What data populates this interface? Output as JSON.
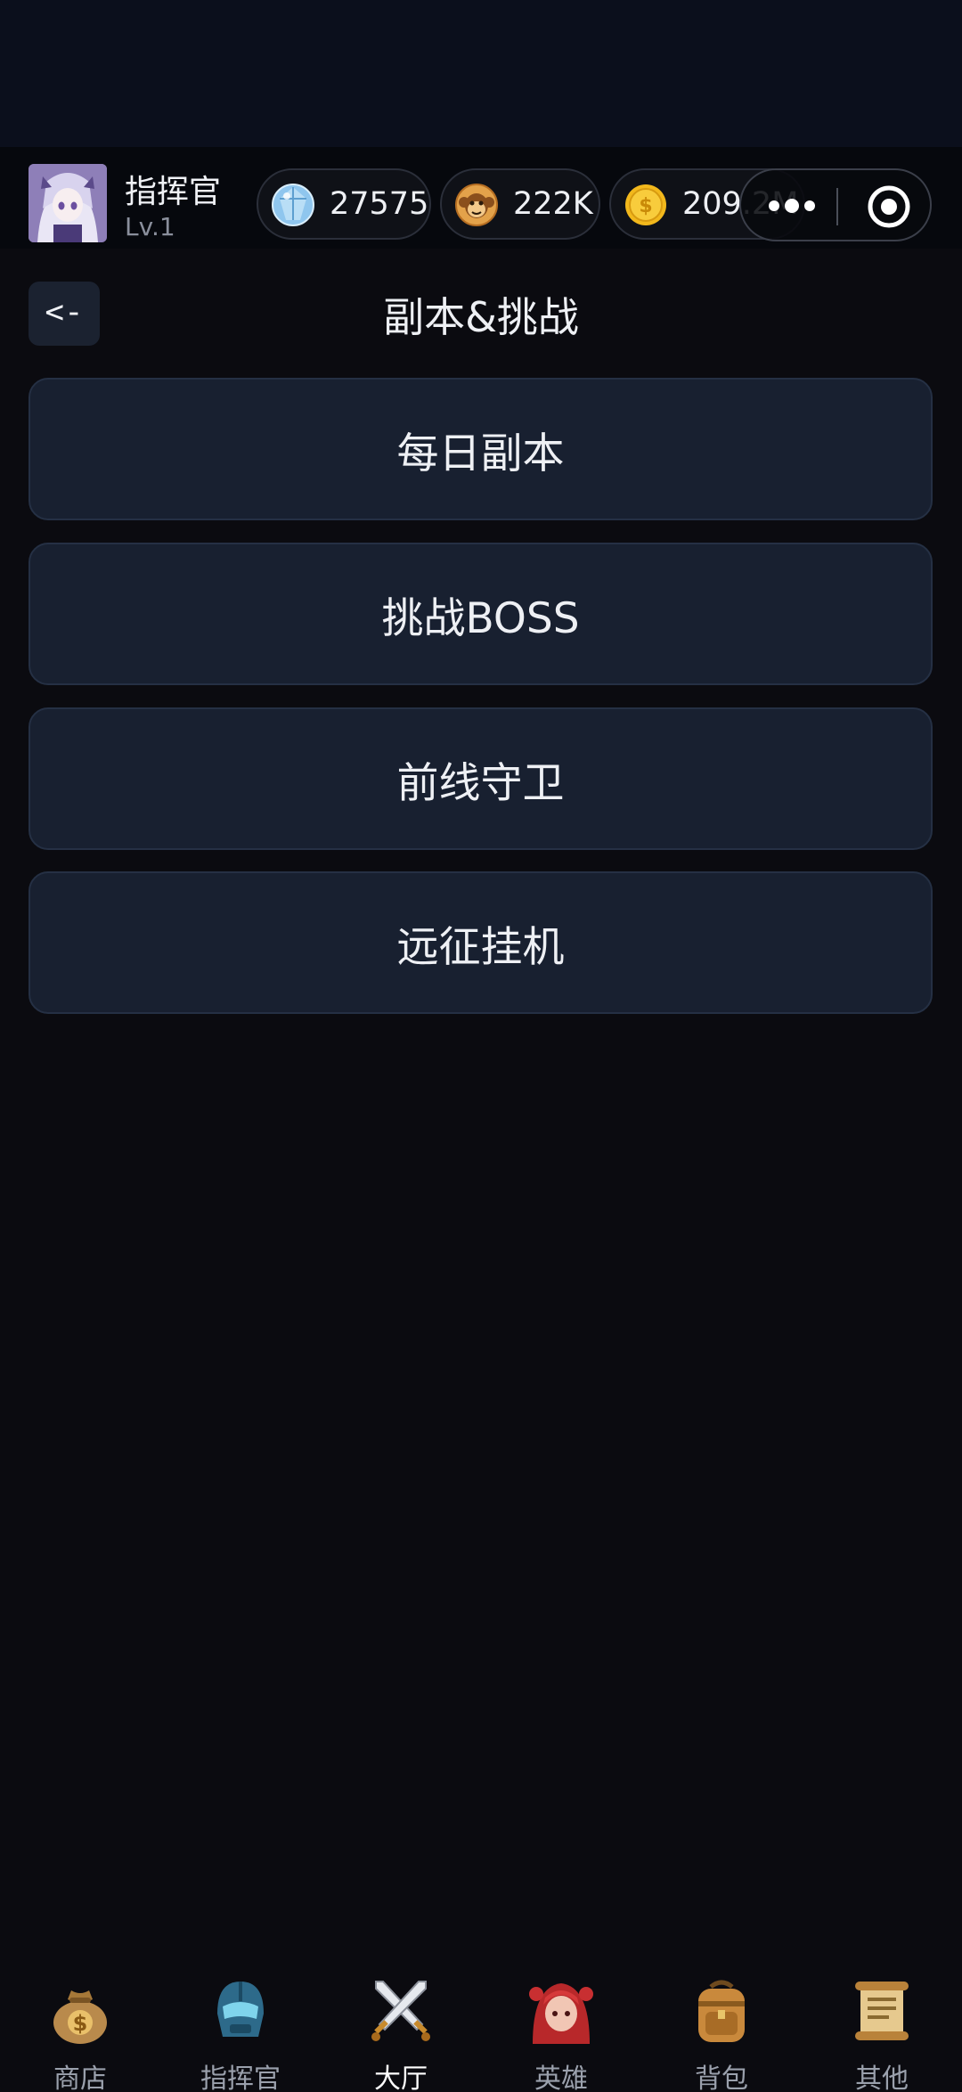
{
  "player": {
    "name": "指挥官",
    "level": "Lv.1"
  },
  "currencies": [
    {
      "icon": "gem-icon",
      "value": "27575"
    },
    {
      "icon": "monkey-coin-icon",
      "value": "222K"
    },
    {
      "icon": "gold-coin-icon",
      "value": "209.2M"
    }
  ],
  "header": {
    "back_label": "<-",
    "title": "副本&挑战"
  },
  "menu": [
    {
      "label": "每日副本"
    },
    {
      "label": "挑战BOSS"
    },
    {
      "label": "前线守卫"
    },
    {
      "label": "远征挂机"
    }
  ],
  "bottom_nav": [
    {
      "label": "商店",
      "icon": "money-bag-icon"
    },
    {
      "label": "指挥官",
      "icon": "helmet-icon"
    },
    {
      "label": "大厅",
      "icon": "crossed-swords-icon",
      "active": true
    },
    {
      "label": "英雄",
      "icon": "hero-portrait-icon"
    },
    {
      "label": "背包",
      "icon": "backpack-icon"
    },
    {
      "label": "其他",
      "icon": "scroll-icon"
    }
  ],
  "colors": {
    "background": "#0b0b10",
    "card": "#182030",
    "card_border": "#253044",
    "text": "#eef0f4",
    "muted_text": "#9aa0ac"
  }
}
